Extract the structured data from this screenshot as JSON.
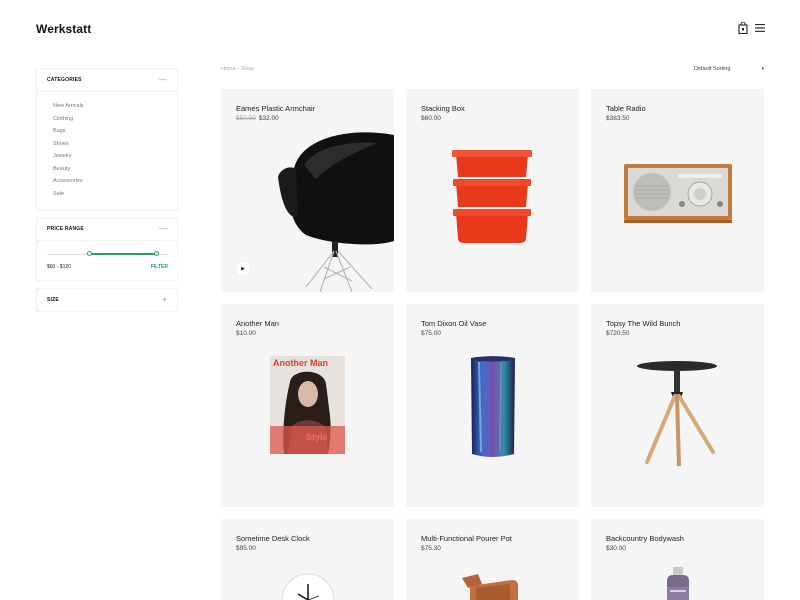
{
  "brand": "Werkstatt",
  "colors": {
    "accent": "#29a45c",
    "card_bg": "#f5f5f5"
  },
  "header": {
    "bag_icon": "shopping-bag-icon",
    "menu_icon": "hamburger-menu-icon"
  },
  "sidebar": {
    "categories": {
      "title": "CATEGORIES",
      "toggle": "—",
      "items": [
        "New Arrivals",
        "Clothing",
        "Bags",
        "Shoes",
        "Jewelry",
        "Beauty",
        "Accessories",
        "Sale"
      ]
    },
    "price_range": {
      "title": "PRICE RANGE",
      "toggle": "—",
      "label": "$60 - $120",
      "filter_label": "FILTER",
      "min_fraction": 0.35,
      "max_fraction": 0.9
    },
    "size": {
      "title": "SIZE",
      "toggle": "+"
    }
  },
  "breadcrumb": {
    "home": "Home",
    "separator": " - ",
    "current": "Shop"
  },
  "sort": {
    "selected": "Default Sorting",
    "chevron": "▾"
  },
  "products": [
    {
      "name": "Eames Plastic Armchair",
      "old_price": "$50.00",
      "price": "$32.00",
      "image": "black-plastic-armchair"
    },
    {
      "name": "Stacking Box",
      "price": "$60.00",
      "image": "red-stacking-boxes"
    },
    {
      "name": "Table Radio",
      "price": "$383.50",
      "image": "wooden-table-radio"
    },
    {
      "name": "Another Man",
      "price": "$10.00",
      "image": "magazine-cover",
      "image_text_top": "Another Man",
      "image_text_bottom": "Style"
    },
    {
      "name": "Tom Dixon Oil Vase",
      "price": "$75.00",
      "image": "iridescent-vase"
    },
    {
      "name": "Topsy The Wild Bunch",
      "price": "$720.50",
      "image": "tripod-side-table"
    },
    {
      "name": "Sometime Desk Clock",
      "price": "$95.00",
      "image": "desk-clock"
    },
    {
      "name": "Multi-Functional Pourer Pot",
      "price": "$75.30",
      "image": "copper-pourer-pot"
    },
    {
      "name": "Backcountry Bodywash",
      "price": "$30.00",
      "image": "bodywash-bottle"
    }
  ]
}
